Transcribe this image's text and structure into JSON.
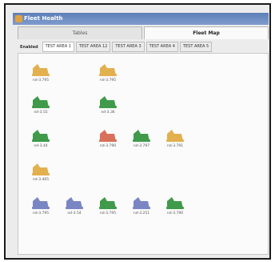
{
  "window": {
    "title": "Fleet Health"
  },
  "tabs": [
    {
      "label": "Tables",
      "active": false
    },
    {
      "label": "Fleet Map",
      "active": true
    }
  ],
  "subtabs": {
    "label": "Enabled",
    "items": [
      {
        "label": "TEST AREA 1",
        "active": true
      },
      {
        "label": "TEST AREA 12",
        "active": false
      },
      {
        "label": "TEST AREA 3",
        "active": false
      },
      {
        "label": "TEST AREA 4",
        "active": false
      },
      {
        "label": "TEST AREA 5",
        "active": false
      }
    ]
  },
  "status_colors": {
    "yellow": "#e2b04e",
    "green": "#3f9a4a",
    "red": "#d8705a",
    "blue": "#7a86c4"
  },
  "nodes": [
    {
      "label": "nd-3.795",
      "status": "yellow"
    },
    {
      "label": "nd-3.795",
      "status": "yellow"
    },
    {
      "label": "nd-3.55",
      "status": "green"
    },
    {
      "label": "nd-3.36",
      "status": "green"
    },
    {
      "label": "nd-3.44",
      "status": "green"
    },
    {
      "label": "nd-3.790",
      "status": "red"
    },
    {
      "label": "nd-3.797",
      "status": "green"
    },
    {
      "label": "nd-3.791",
      "status": "yellow"
    },
    {
      "label": "nd-3.465",
      "status": "yellow"
    },
    {
      "label": "nd-3.795",
      "status": "blue"
    },
    {
      "label": "nd-3.54",
      "status": "blue"
    },
    {
      "label": "nd-3.795",
      "status": "green"
    },
    {
      "label": "nd-3.251",
      "status": "blue"
    },
    {
      "label": "nd-3.790",
      "status": "green"
    }
  ]
}
